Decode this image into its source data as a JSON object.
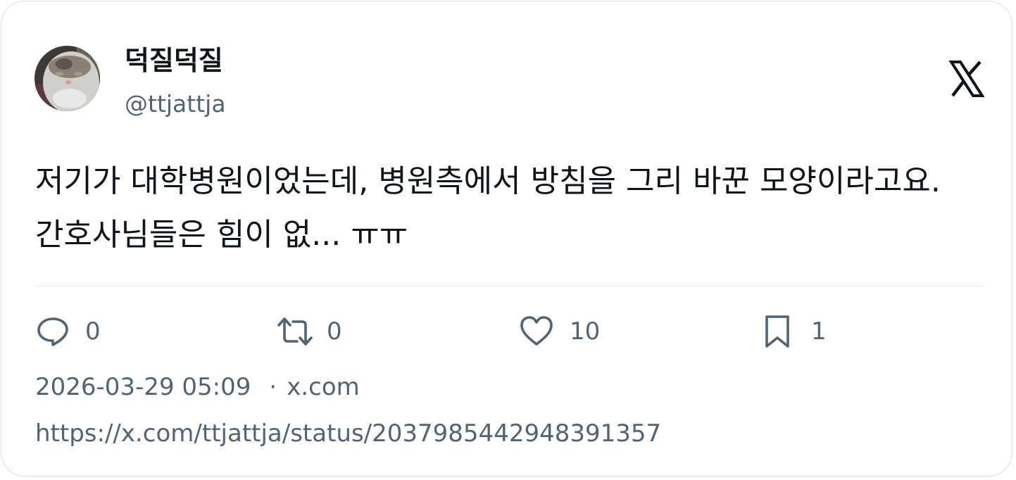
{
  "author": {
    "display_name": "덕질덕질",
    "handle": "@ttjattja"
  },
  "brand_icon": "x-logo-icon",
  "tweet": {
    "text": "저기가 대학병원이었는데, 병원측에서 방침을 그리 바꾼 모양이라고요. 간호사님들은 힘이 없... ㅠㅠ"
  },
  "actions": {
    "reply": {
      "icon": "reply-icon",
      "count": "0"
    },
    "retweet": {
      "icon": "retweet-icon",
      "count": "0"
    },
    "like": {
      "icon": "heart-icon",
      "count": "10"
    },
    "bookmark": {
      "icon": "bookmark-icon",
      "count": "1"
    }
  },
  "meta": {
    "timestamp": "2026-03-29 05:09",
    "separator": "·",
    "source": "x.com"
  },
  "status_url": "https://x.com/ttjattja/status/2037985442948391357",
  "colors": {
    "text_primary": "#0f1419",
    "text_secondary": "#536471",
    "border": "#d9dde1"
  }
}
